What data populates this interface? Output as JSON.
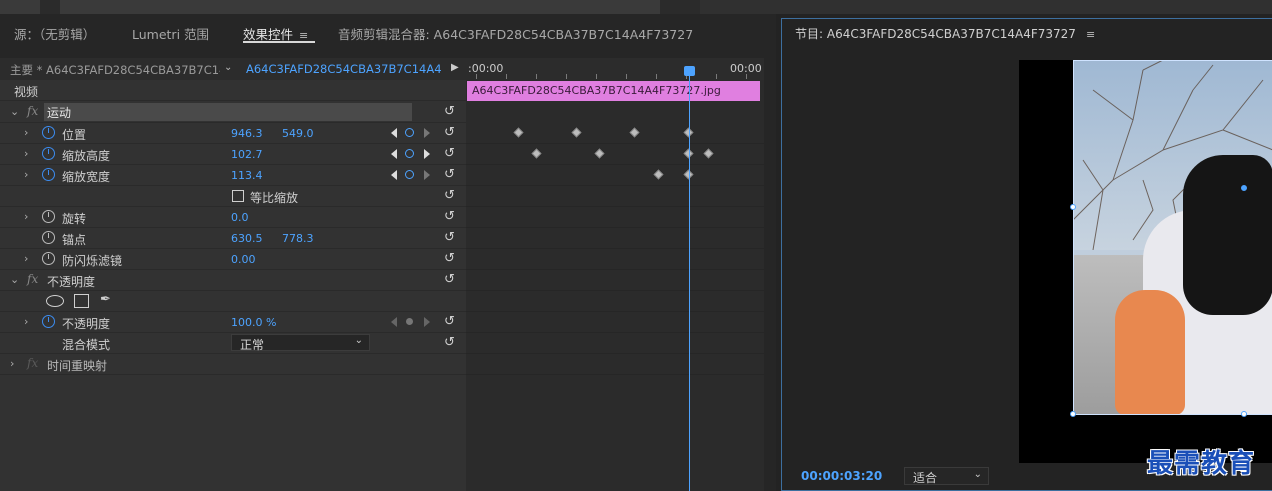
{
  "tabs": {
    "source": "源：（无剪辑）",
    "lumetri": "Lumetri 范围",
    "effect_controls": "效果控件",
    "audio_mixer": "音频剪辑混合器: A64C3FAFD28C54CBA37B7C14A4F73727",
    "menu_glyph": "≡"
  },
  "source_bar": {
    "master": "主要 * A64C3FAFD28C54CBA37B7C14...",
    "clip": "A64C3FAFD28C54CBA37B7C14A4F7..."
  },
  "ruler": {
    "start": ":00:00",
    "end": "00:00"
  },
  "clip_name": "A64C3FAFD28C54CBA37B7C14A4F73727.jpg",
  "sections": {
    "video": "视频"
  },
  "motion": {
    "name": "运动",
    "position": {
      "label": "位置",
      "x": "946.3",
      "y": "549.0"
    },
    "scale_height": {
      "label": "缩放高度",
      "value": "102.7"
    },
    "scale_width": {
      "label": "缩放宽度",
      "value": "113.4"
    },
    "uniform_scale": {
      "label": "等比缩放"
    },
    "rotation": {
      "label": "旋转",
      "value": "0.0"
    },
    "anchor": {
      "label": "锚点",
      "x": "630.5",
      "y": "778.3"
    },
    "anti_flicker": {
      "label": "防闪烁滤镜",
      "value": "0.00"
    }
  },
  "opacity": {
    "name": "不透明度",
    "param": {
      "label": "不透明度",
      "value": "100.0 %"
    },
    "blend": {
      "label": "混合模式",
      "value": "正常"
    }
  },
  "time_remap": {
    "name": "时间重映射"
  },
  "program": {
    "title": "节目: A64C3FAFD28C54CBA37B7C14A4F73727",
    "timecode": "00:00:03:20",
    "fit": "适合"
  },
  "watermark": "最需教育",
  "icons": {
    "reset": "reset-icon",
    "stopwatch": "stopwatch-icon",
    "chevron": "chevron-right-icon"
  },
  "colors": {
    "accent": "#4da3ff",
    "clip": "#e07fe0"
  }
}
